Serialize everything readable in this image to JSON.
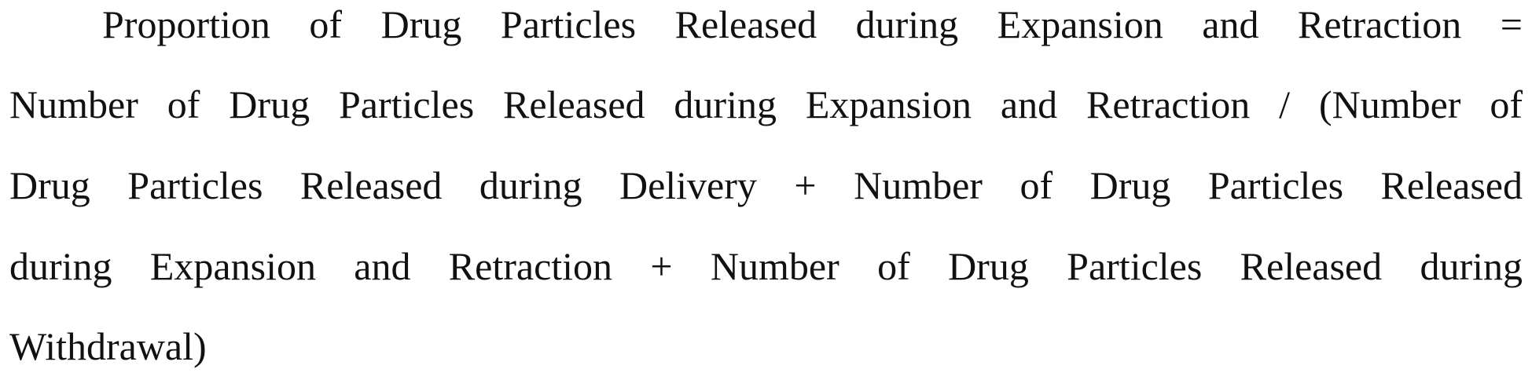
{
  "formula": {
    "lines": [
      "Proportion of Drug Particles Released during Expansion and Retraction =",
      "Number of Drug Particles Released during Expansion and Retraction / (Number of",
      "Drug Particles Released during Delivery + Number of Drug Particles Released",
      "during Expansion and Retraction + Number of Drug Particles Released during",
      "Withdrawal)"
    ]
  }
}
